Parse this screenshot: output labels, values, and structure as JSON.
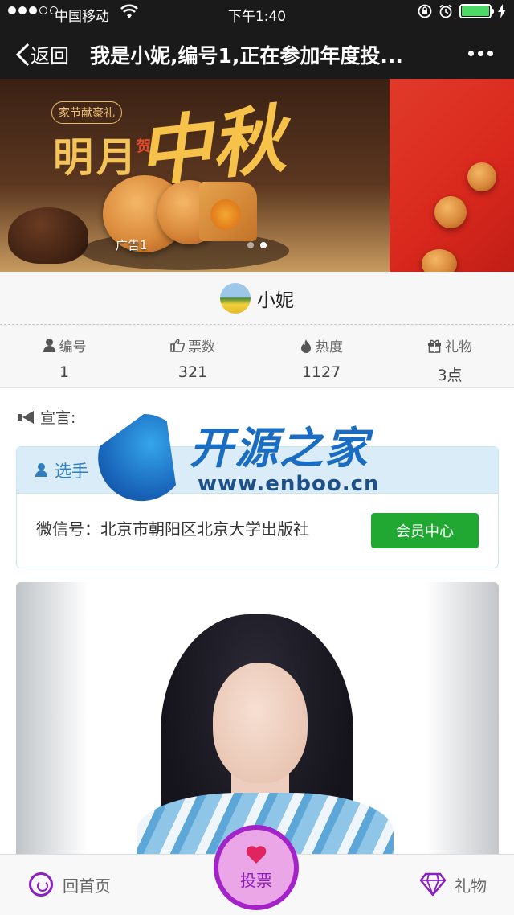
{
  "status_bar": {
    "carrier": "中国移动",
    "time": "下午1:40"
  },
  "nav": {
    "back_label": "返回",
    "title": "我是小妮,编号1,正在参加年度投..."
  },
  "banner": {
    "slide1_tag": "家节献豪礼",
    "slide1_title_a": "明月",
    "slide1_title_b": "中秋",
    "slide1_small": "贺",
    "caption": "广告1",
    "active_slide": 2,
    "slide_count": 2
  },
  "profile": {
    "name": "小妮"
  },
  "stats": [
    {
      "label": "编号",
      "value": "1",
      "icon": "user-icon"
    },
    {
      "label": "票数",
      "value": "321",
      "icon": "thumbs-up-icon"
    },
    {
      "label": "热度",
      "value": "1127",
      "icon": "flame-icon"
    },
    {
      "label": "礼物",
      "value": "3点",
      "icon": "gift-icon"
    }
  ],
  "slogan": {
    "label": "宣言:"
  },
  "card": {
    "header": "选手",
    "wechat_label": "微信号：北京市朝阳区北京大学出版社",
    "member_button": "会员中心"
  },
  "watermark": {
    "name": "开源之家",
    "url": "www.enboo.cn"
  },
  "bottom": {
    "home_label": "回首页",
    "vote_label": "投票",
    "gift_label": "礼物"
  },
  "colors": {
    "accent_purple": "#a323c9",
    "button_green": "#21a833",
    "card_header_blue": "#2f7fbe"
  }
}
